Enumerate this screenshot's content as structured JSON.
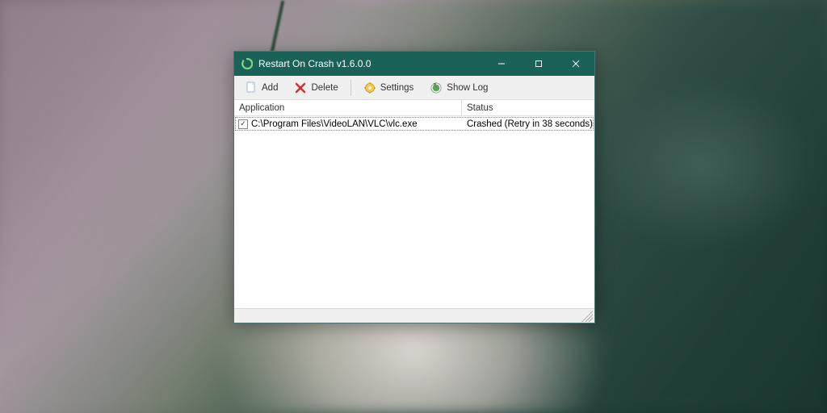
{
  "window": {
    "title": "Restart On Crash v1.6.0.0"
  },
  "toolbar": {
    "add_label": "Add",
    "delete_label": "Delete",
    "settings_label": "Settings",
    "showlog_label": "Show Log"
  },
  "columns": {
    "application": "Application",
    "status": "Status"
  },
  "rows": [
    {
      "checked": true,
      "application": "C:\\Program Files\\VideoLAN\\VLC\\vlc.exe",
      "status": "Crashed (Retry in 38 seconds)"
    }
  ]
}
